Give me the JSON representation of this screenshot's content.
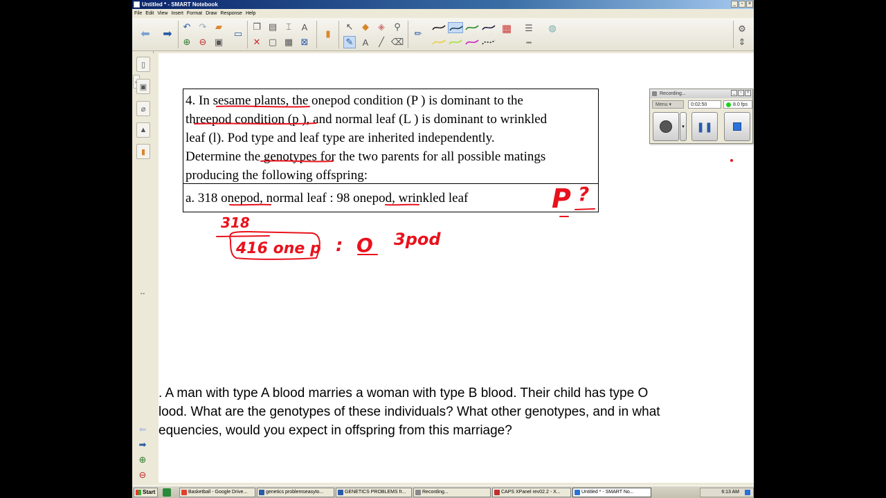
{
  "window": {
    "title": "Untitled * - SMART Notebook"
  },
  "menu": [
    "File",
    "Edit",
    "View",
    "Insert",
    "Format",
    "Draw",
    "Response",
    "Help"
  ],
  "question4": {
    "lines": [
      "4. In sesame plants, the onepod condition (P ) is dominant to the",
      "threepod condition (p ), and normal leaf (L ) is dominant to wrinkled",
      "leaf (l). Pod type and leaf type are inherited independently.",
      "Determine the genotypes for the two parents for all possible matings",
      "producing the following offspring:"
    ],
    "part_a": "a. 318 onepod, normal leaf : 98 onepod, wrinkled leaf"
  },
  "handwriting": {
    "p_mark": "P",
    "q_mark": "?",
    "count": "318",
    "ratio_left": "416 one p",
    "colon": ":",
    "zero": "O",
    "ratio_right": "3pod"
  },
  "blood_question": {
    "lines": [
      ". A man with type A blood marries a woman with type B blood. Their child has type O",
      "lood. What are the genotypes of these individuals? What other genotypes, and in what",
      "equencies, would you expect in offspring from this marriage?"
    ]
  },
  "recorder": {
    "title": "Recording...",
    "menu_label": "Menu",
    "timer": "0:02:50",
    "fps": "8.0 fps"
  },
  "taskbar": {
    "start": "Start",
    "tasks": [
      "Basketball - Google Drive...",
      "genetics problemseasyto...",
      "GENETICS PROBLEMS fr...",
      "Recording...",
      "CAPS XPanel rev02.2 - X...",
      "Untitled * - SMART No..."
    ],
    "clock": "6:13 AM"
  },
  "colors": {
    "ink_red": "#e8121c",
    "titlebar": "#0a246a"
  }
}
